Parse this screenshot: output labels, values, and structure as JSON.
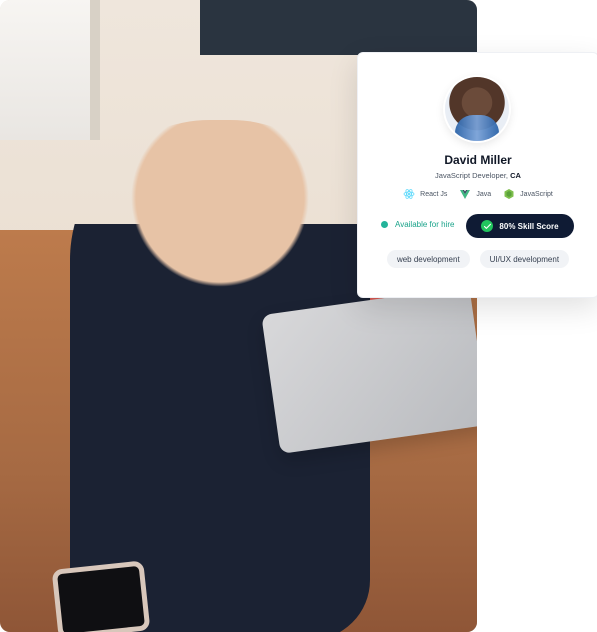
{
  "profile_card": {
    "name": "David Miller",
    "role_prefix": "JavaScript Developer, ",
    "location": "CA",
    "skills": [
      {
        "label": "React Js",
        "icon": "react-icon"
      },
      {
        "label": "Java",
        "icon": "vue-icon"
      },
      {
        "label": "JavaScript",
        "icon": "nodejs-icon"
      }
    ],
    "availability": "Available for hire",
    "skill_score": "80% Skill Score",
    "tags": [
      "web development",
      "UI/UX development"
    ]
  },
  "colors": {
    "navy": "#0f1b34",
    "green": "#22c55e",
    "teal_text": "#1aa38a"
  }
}
